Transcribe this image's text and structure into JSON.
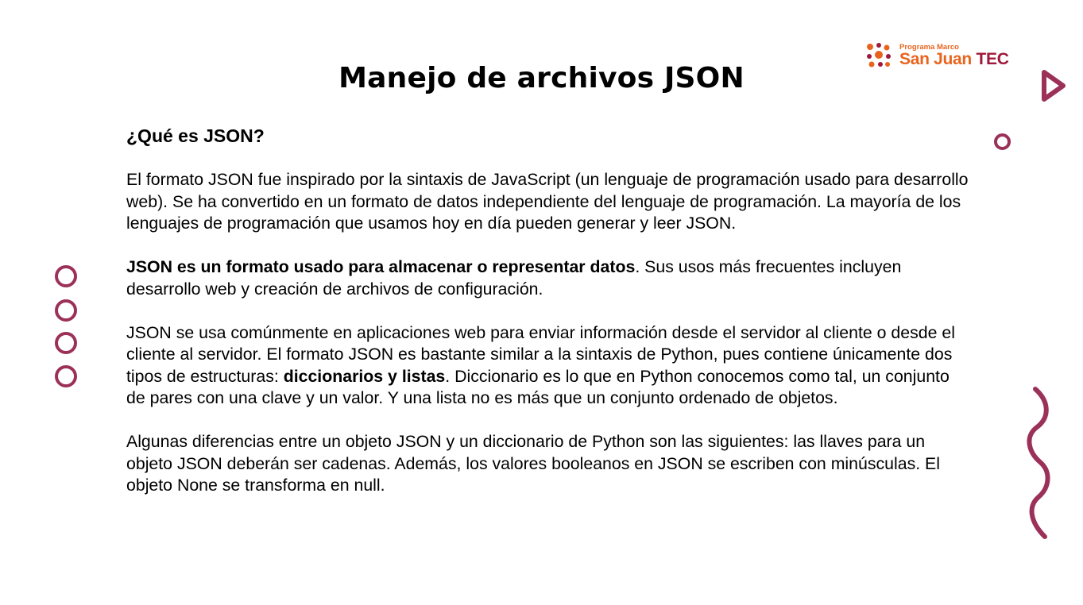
{
  "slide": {
    "title": "Manejo de archivos JSON",
    "heading": "¿Qué es JSON?",
    "p1": "El formato JSON fue inspirado por la sintaxis de JavaScript (un lenguaje de programación usado para desarrollo web). Se ha convertido en un formato de datos independiente del lenguaje de programación. La mayoría de los lenguajes de programación que usamos hoy en día pueden generar y leer JSON.",
    "p2_bold": "JSON es un formato usado para almacenar o representar datos",
    "p2_rest": ". Sus usos más frecuentes incluyen desarrollo web y creación de archivos de configuración.",
    "p3_a": "JSON se usa comúnmente en aplicaciones web para enviar información desde el servidor al cliente o desde el cliente al servidor. El formato JSON es bastante similar a la sintaxis de Python, pues contiene únicamente dos tipos de estructuras: ",
    "p3_bold": "diccionarios y listas",
    "p3_b": ". Diccionario es lo que en Python conocemos como tal, un conjunto de pares con una clave y un valor. Y una lista no es más que un conjunto ordenado de objetos.",
    "p4": "Algunas diferencias entre un objeto JSON y un diccionario de Python son las siguientes: las llaves para un objeto JSON deberán ser cadenas. Además, los valores booleanos en JSON se escriben con minúsculas. El objeto None se transforma en null."
  },
  "logo": {
    "small": "Programa Marco",
    "big_a": "San Juan ",
    "big_b": "TEC"
  },
  "colors": {
    "accent": "#9b3159",
    "logo_orange": "#e8641e",
    "logo_red": "#a0183a"
  },
  "icons": [
    "play-triangle-icon",
    "ring-icon",
    "wave-icon",
    "logo-mark-icon"
  ]
}
